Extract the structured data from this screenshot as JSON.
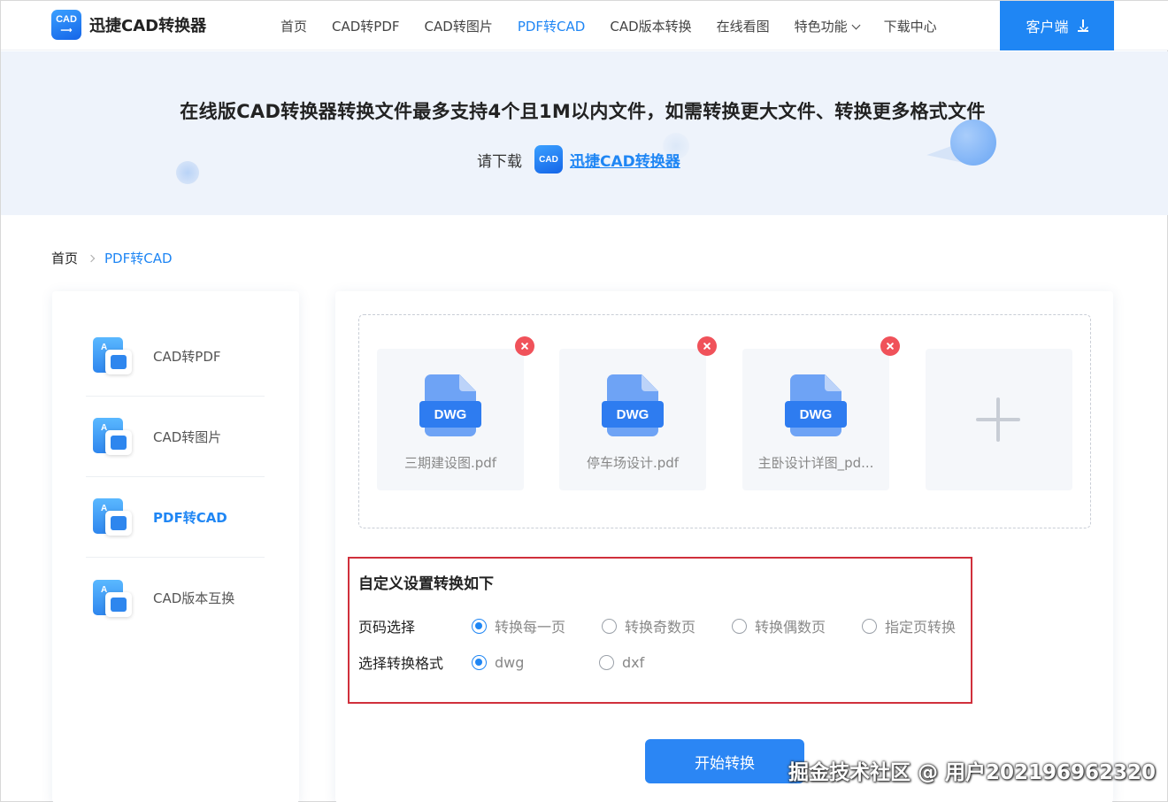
{
  "header": {
    "logo_badge": "CAD",
    "logo_text": "迅捷CAD转换器",
    "nav": [
      {
        "label": "首页",
        "active": false
      },
      {
        "label": "CAD转PDF",
        "active": false
      },
      {
        "label": "CAD转图片",
        "active": false
      },
      {
        "label": "PDF转CAD",
        "active": true
      },
      {
        "label": "CAD版本转换",
        "active": false
      },
      {
        "label": "在线看图",
        "active": false
      },
      {
        "label": "特色功能",
        "active": false,
        "dropdown": true
      },
      {
        "label": "下载中心",
        "active": false
      }
    ],
    "client_button": "客户端",
    "accent_color": "#1f86f4"
  },
  "banner": {
    "title": "在线版CAD转换器转换文件最多支持4个且1M以内文件，如需转换更大文件、转换更多格式文件",
    "pre_text": "请下载",
    "badge": "CAD",
    "link": "迅捷CAD转换器"
  },
  "breadcrumb": {
    "home": "首页",
    "current": "PDF转CAD"
  },
  "sidebar": {
    "items": [
      {
        "label": "CAD转PDF",
        "icon": "cad-to-pdf-icon",
        "active": false
      },
      {
        "label": "CAD转图片",
        "icon": "cad-to-image-icon",
        "active": false
      },
      {
        "label": "PDF转CAD",
        "icon": "pdf-to-cad-icon",
        "active": true
      },
      {
        "label": "CAD版本互换",
        "icon": "cad-version-icon",
        "active": false
      }
    ]
  },
  "files": [
    {
      "type": "DWG",
      "name": "三期建设图.pdf"
    },
    {
      "type": "DWG",
      "name": "停车场设计.pdf"
    },
    {
      "type": "DWG",
      "name": "主卧设计详图_pd..."
    }
  ],
  "settings": {
    "title": "自定义设置转换如下",
    "page_label": "页码选择",
    "page_options": [
      {
        "label": "转换每一页",
        "selected": true
      },
      {
        "label": "转换奇数页",
        "selected": false
      },
      {
        "label": "转换偶数页",
        "selected": false
      },
      {
        "label": "指定页转换",
        "selected": false
      }
    ],
    "format_label": "选择转换格式",
    "format_options": [
      {
        "label": "dwg",
        "selected": true
      },
      {
        "label": "dxf",
        "selected": false
      }
    ]
  },
  "start_button": "开始转换",
  "watermark": "掘金技术社区 @ 用户202196962320"
}
